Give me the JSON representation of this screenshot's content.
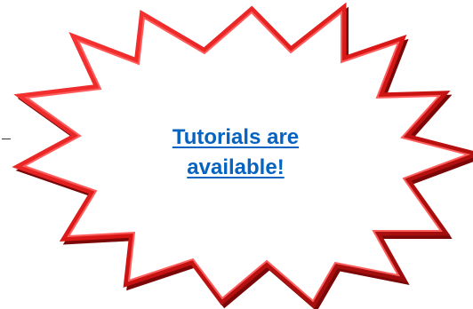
{
  "callout": {
    "link_line1": "Tutorials are",
    "link_line2": "available!",
    "link_color": "#0563C1",
    "outline_color": "#E01818",
    "outline_shadow_color": "#8B0A0A",
    "fill_color": "#FFFFFF",
    "shape_icon": "starburst-icon"
  }
}
